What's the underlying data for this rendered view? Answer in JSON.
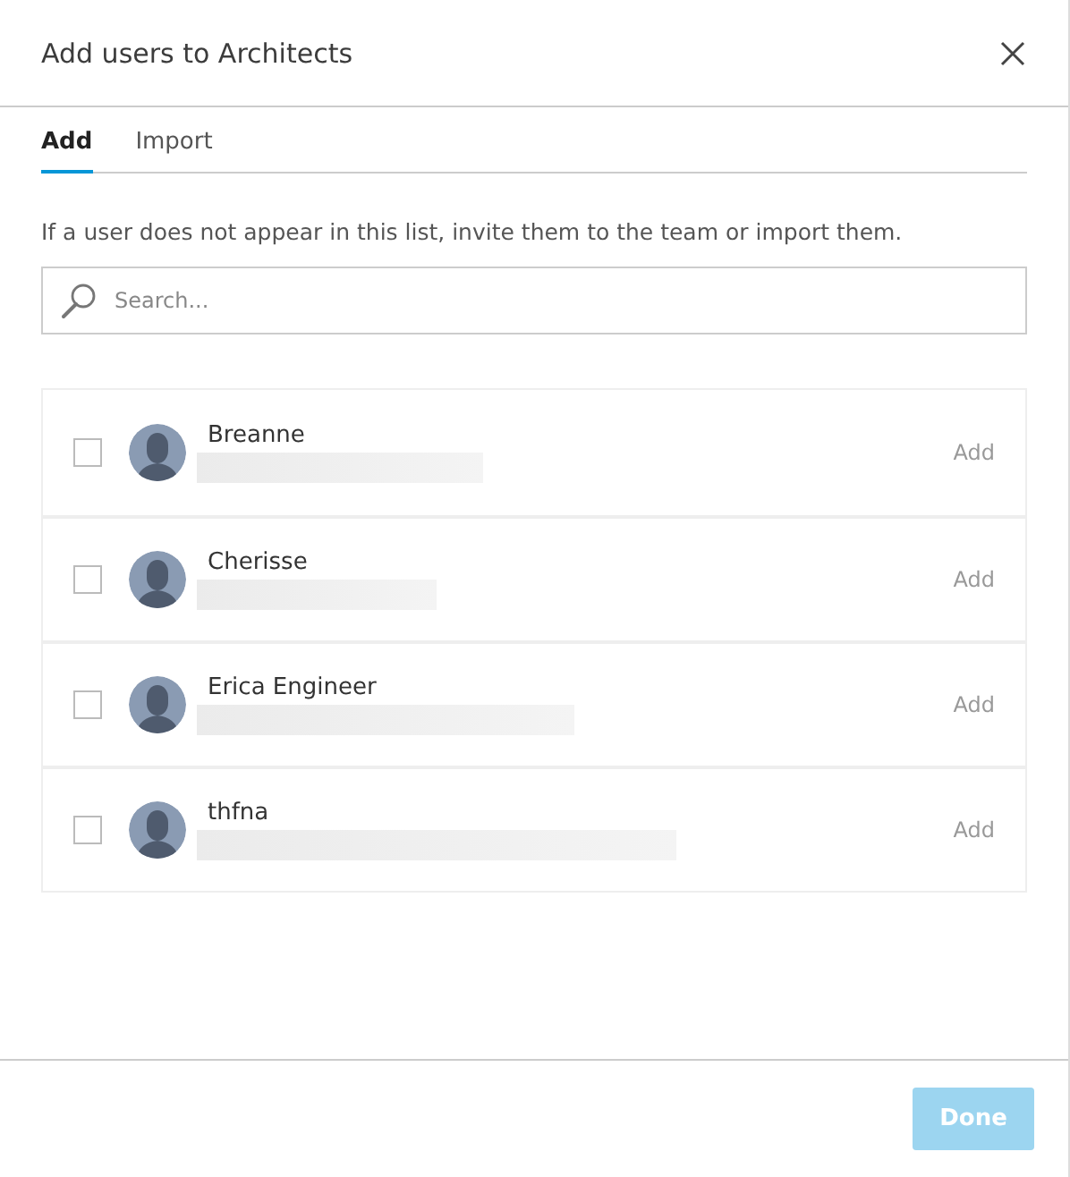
{
  "dialog": {
    "title": "Add users to Architects"
  },
  "tabs": [
    {
      "label": "Add",
      "selected": true
    },
    {
      "label": "Import",
      "selected": false
    }
  ],
  "hint": "If a user does not appear in this list, invite them to the team or import them.",
  "search": {
    "placeholder": "Search..."
  },
  "users": [
    {
      "name": "Breanne",
      "checked": false,
      "action": "Add"
    },
    {
      "name": "Cherisse",
      "checked": false,
      "action": "Add"
    },
    {
      "name": "Erica Engineer",
      "checked": false,
      "action": "Add"
    },
    {
      "name": "thfna",
      "checked": false,
      "action": "Add"
    }
  ],
  "done_button": {
    "label": "Done",
    "disabled": true
  }
}
